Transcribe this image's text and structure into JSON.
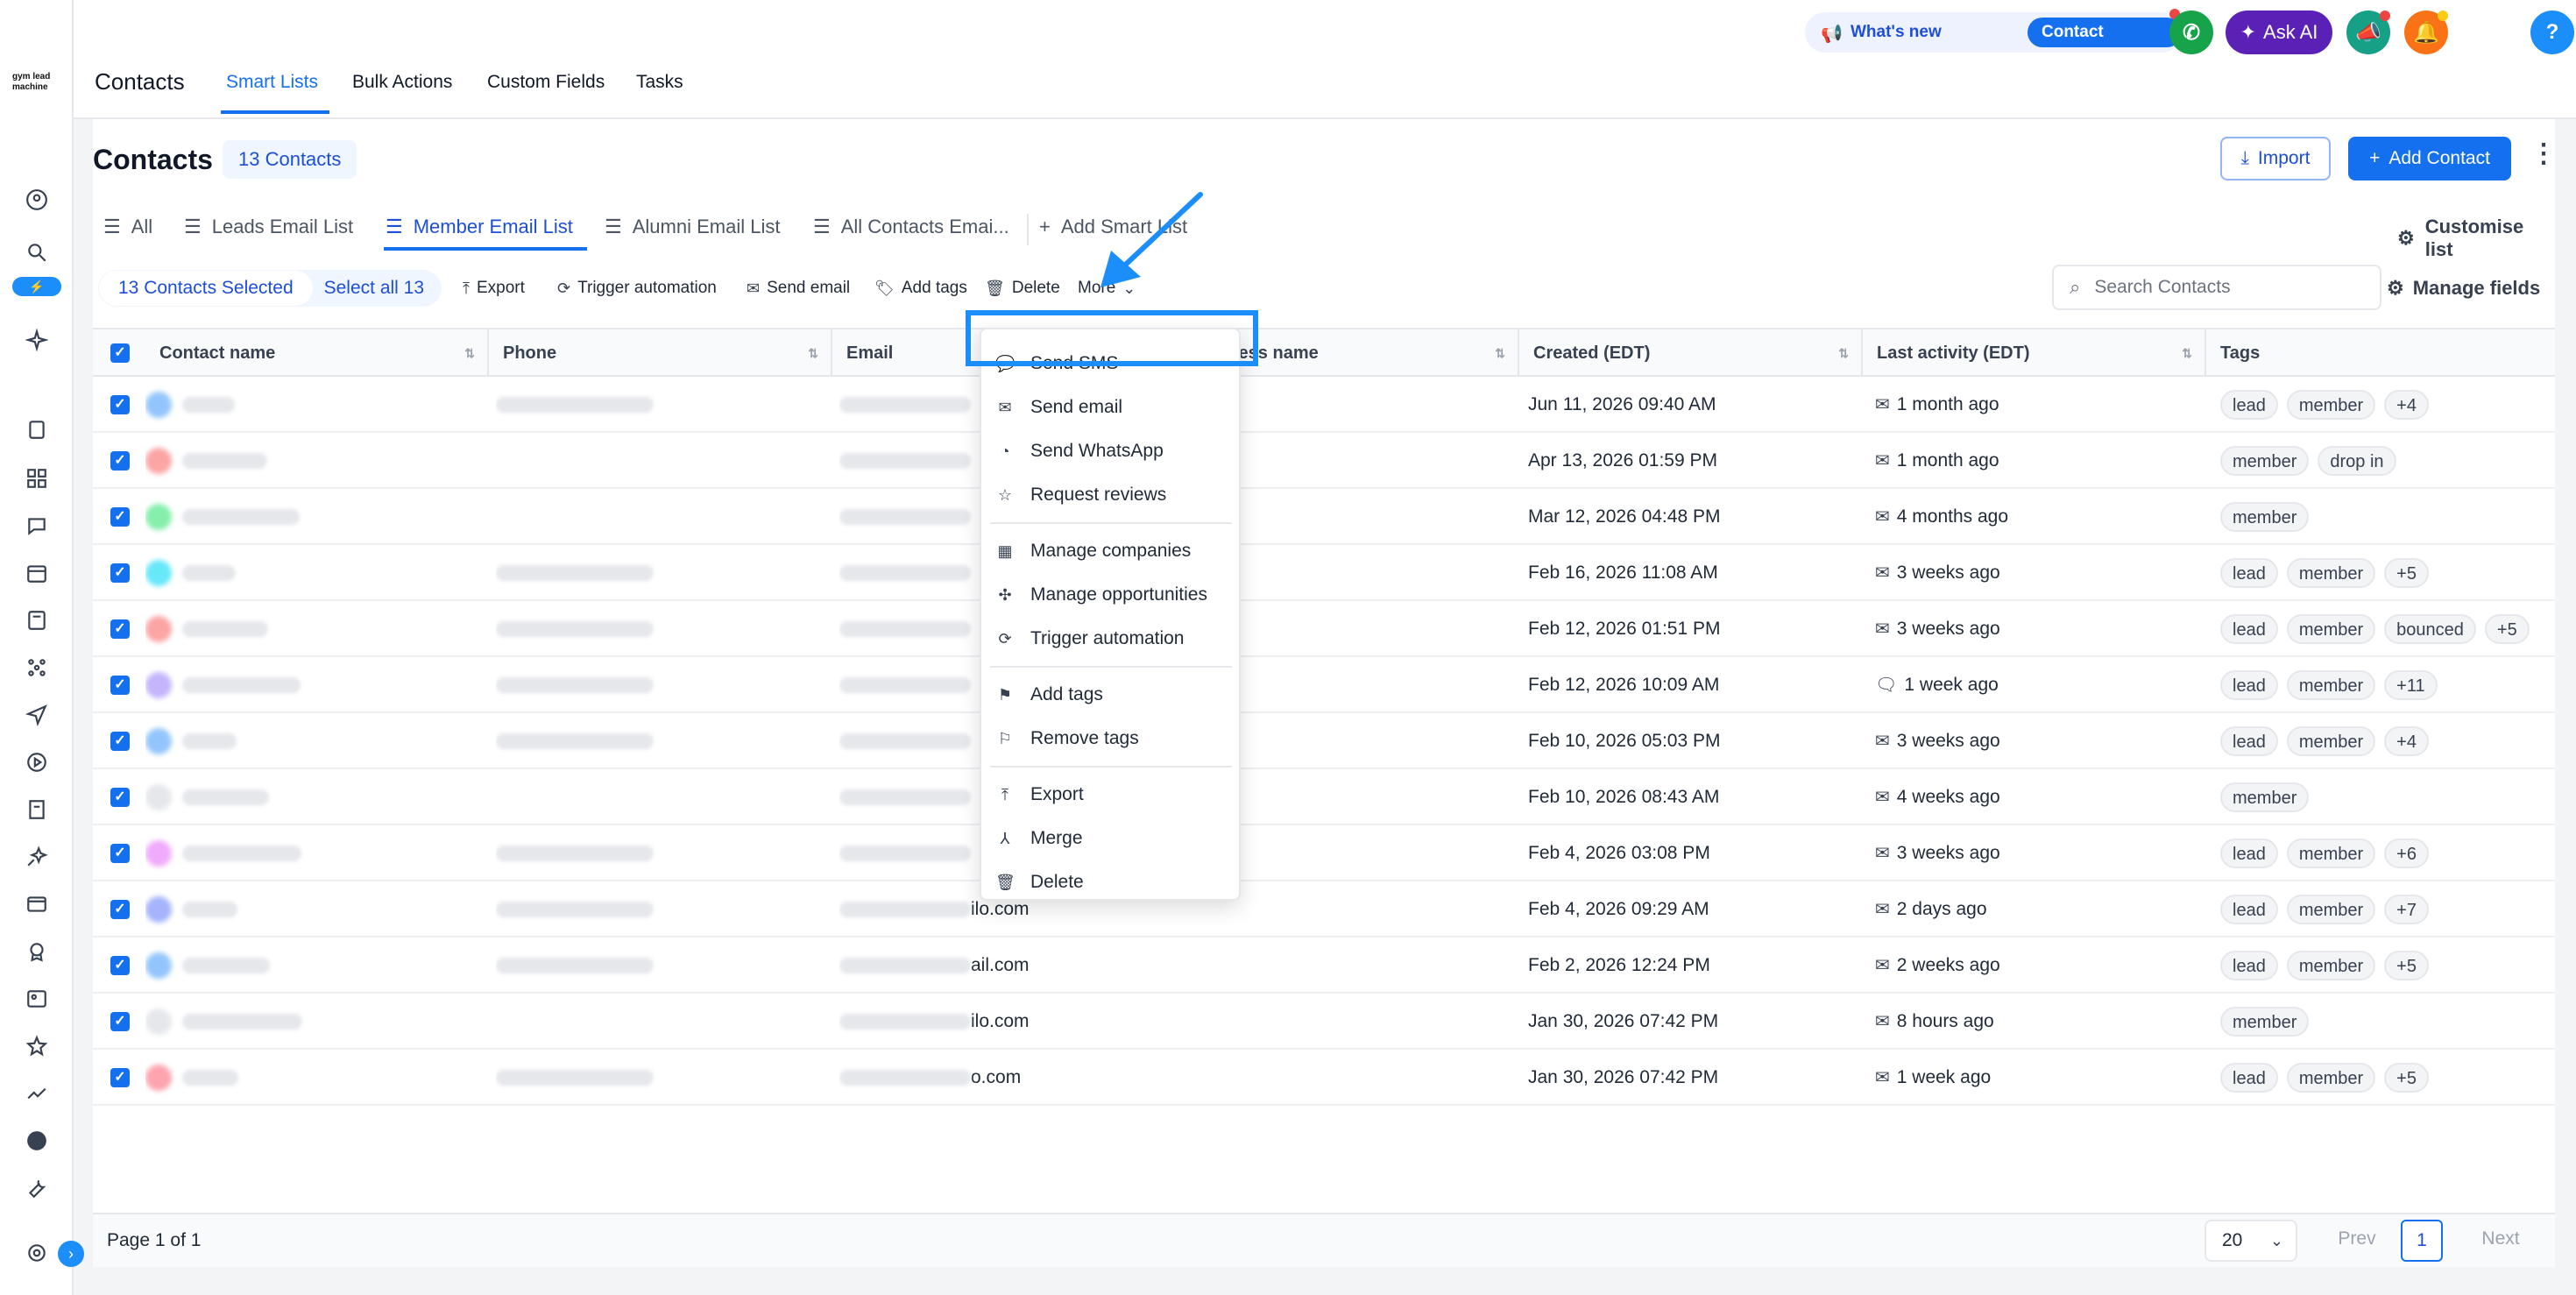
{
  "header": {
    "app_title": "Contacts",
    "tabs": [
      "Smart Lists",
      "Bulk Actions",
      "Custom Fields",
      "Tasks"
    ],
    "whats_new": "What's new",
    "contact_updates": "Contact updates",
    "ask_ai": "Ask AI",
    "help": "?"
  },
  "sidebar": {
    "logo": "gym lead machine"
  },
  "page": {
    "title": "Contacts",
    "count_badge": "13 Contacts",
    "import_label": "Import",
    "add_contact_label": "Add Contact"
  },
  "smart_lists": {
    "tabs": [
      "All",
      "Leads Email List",
      "Member Email List",
      "Alumni Email List",
      "All Contacts Emai...",
      "Add Smart List"
    ],
    "customise": "Customise list"
  },
  "bulk": {
    "selected": "13 Contacts Selected",
    "select_all": "Select all 13",
    "actions": [
      "Export",
      "Trigger automation",
      "Send email",
      "Add tags",
      "Delete",
      "More"
    ]
  },
  "search": {
    "placeholder": "Search Contacts"
  },
  "manage_fields": "Manage fields",
  "table": {
    "columns": [
      "Contact name",
      "Phone",
      "Email",
      "Business name",
      "Created (EDT)",
      "Last activity (EDT)",
      "Tags"
    ],
    "rows": [
      {
        "email": "",
        "created": "Jun 11, 2026 09:40 AM",
        "activity": "1 month ago",
        "activity_icon": "mail",
        "tags": [
          "lead",
          "member",
          "+4"
        ]
      },
      {
        "email": "",
        "created": "Apr 13, 2026 01:59 PM",
        "activity": "1 month ago",
        "activity_icon": "mail",
        "tags": [
          "member",
          "drop in"
        ]
      },
      {
        "email": "",
        "created": "Mar 12, 2026 04:48 PM",
        "activity": "4 months ago",
        "activity_icon": "mail",
        "tags": [
          "member"
        ]
      },
      {
        "email": "",
        "created": "Feb 16, 2026 11:08 AM",
        "activity": "3 weeks ago",
        "activity_icon": "mail",
        "tags": [
          "lead",
          "member",
          "+5"
        ]
      },
      {
        "email": "",
        "created": "Feb 12, 2026 01:51 PM",
        "activity": "3 weeks ago",
        "activity_icon": "mail",
        "tags": [
          "lead",
          "member",
          "bounced",
          "+5"
        ]
      },
      {
        "email": "",
        "created": "Feb 12, 2026 10:09 AM",
        "activity": "1 week ago",
        "activity_icon": "chat",
        "tags": [
          "lead",
          "member",
          "+11"
        ]
      },
      {
        "email": "",
        "created": "Feb 10, 2026 05:03 PM",
        "activity": "3 weeks ago",
        "activity_icon": "mail",
        "tags": [
          "lead",
          "member",
          "+4"
        ]
      },
      {
        "email": "",
        "created": "Feb 10, 2026 08:43 AM",
        "activity": "4 weeks ago",
        "activity_icon": "mail",
        "tags": [
          "member"
        ]
      },
      {
        "email": "",
        "created": "Feb 4, 2026 03:08 PM",
        "activity": "3 weeks ago",
        "activity_icon": "mail",
        "tags": [
          "lead",
          "member",
          "+6"
        ]
      },
      {
        "email": "ilo.com",
        "created": "Feb 4, 2026 09:29 AM",
        "activity": "2 days ago",
        "activity_icon": "mail",
        "tags": [
          "lead",
          "member",
          "+7"
        ]
      },
      {
        "email": "ail.com",
        "created": "Feb 2, 2026 12:24 PM",
        "activity": "2 weeks ago",
        "activity_icon": "mail",
        "tags": [
          "lead",
          "member",
          "+5"
        ]
      },
      {
        "email": "ilo.com",
        "created": "Jan 30, 2026 07:42 PM",
        "activity": "8 hours ago",
        "activity_icon": "mail",
        "tags": [
          "member"
        ]
      },
      {
        "email": "o.com",
        "created": "Jan 30, 2026 07:42 PM",
        "activity": "1 week ago",
        "activity_icon": "mail",
        "tags": [
          "lead",
          "member",
          "+5"
        ]
      }
    ]
  },
  "more_menu": {
    "items": [
      "Send SMS",
      "Send email",
      "Send WhatsApp",
      "Request reviews",
      "Manage companies",
      "Manage opportunities",
      "Trigger automation",
      "Add tags",
      "Remove tags",
      "Export",
      "Merge",
      "Delete"
    ],
    "highlighted": "Send SMS"
  },
  "footer": {
    "page_info": "Page 1 of 1",
    "per_page": "20",
    "prev": "Prev",
    "current": "1",
    "next": "Next"
  },
  "colors": {
    "accent": "#1570ef",
    "highlight": "#1c8ef9",
    "ask_ai": "#5b21b6"
  }
}
